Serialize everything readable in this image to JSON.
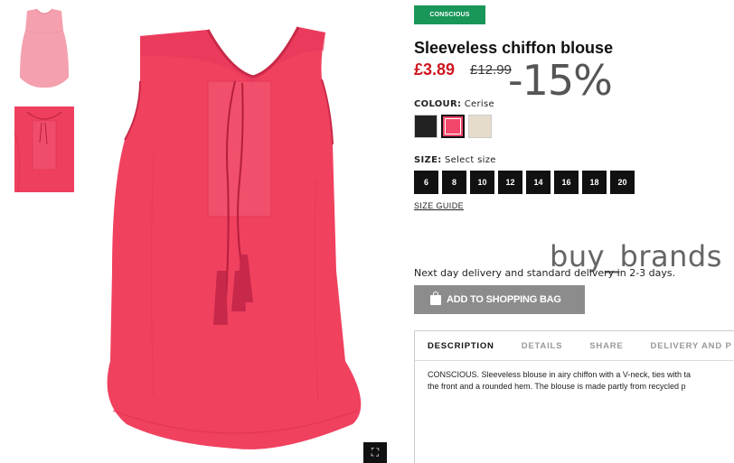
{
  "product": {
    "badge": "CONSCIOUS",
    "title": "Sleeveless chiffon blouse",
    "price_now": "£3.89",
    "price_old": "£12.99",
    "discount": "-15%"
  },
  "colour": {
    "label": "COLOUR:",
    "selected": "Cerise",
    "swatches": [
      {
        "name": "black",
        "color": "#222222"
      },
      {
        "name": "cerise",
        "color": "#f2476a"
      },
      {
        "name": "beige",
        "color": "#e6dccb"
      }
    ]
  },
  "size": {
    "label": "SIZE:",
    "prompt": "Select size",
    "options": [
      "6",
      "8",
      "10",
      "12",
      "14",
      "16",
      "18",
      "20"
    ],
    "guide": "SIZE GUIDE"
  },
  "watermark": "buy_brands",
  "delivery": "Next day delivery and standard delivery in 2-3 days.",
  "cart": {
    "add_label": "ADD TO SHOPPING BAG",
    "icon": "shopping-bag-icon"
  },
  "tabs": [
    "DESCRIPTION",
    "DETAILS",
    "SHARE",
    "DELIVERY AND P"
  ],
  "description": [
    "CONSCIOUS. Sleeveless blouse in airy chiffon with a V-neck, ties with ta",
    "the front and a rounded hem. The blouse is made partly from recycled p"
  ],
  "icons": {
    "fullscreen": "fullscreen-icon"
  },
  "colors": {
    "blouse": "#f0415f",
    "badge": "#19965a",
    "price": "#d0161f"
  }
}
